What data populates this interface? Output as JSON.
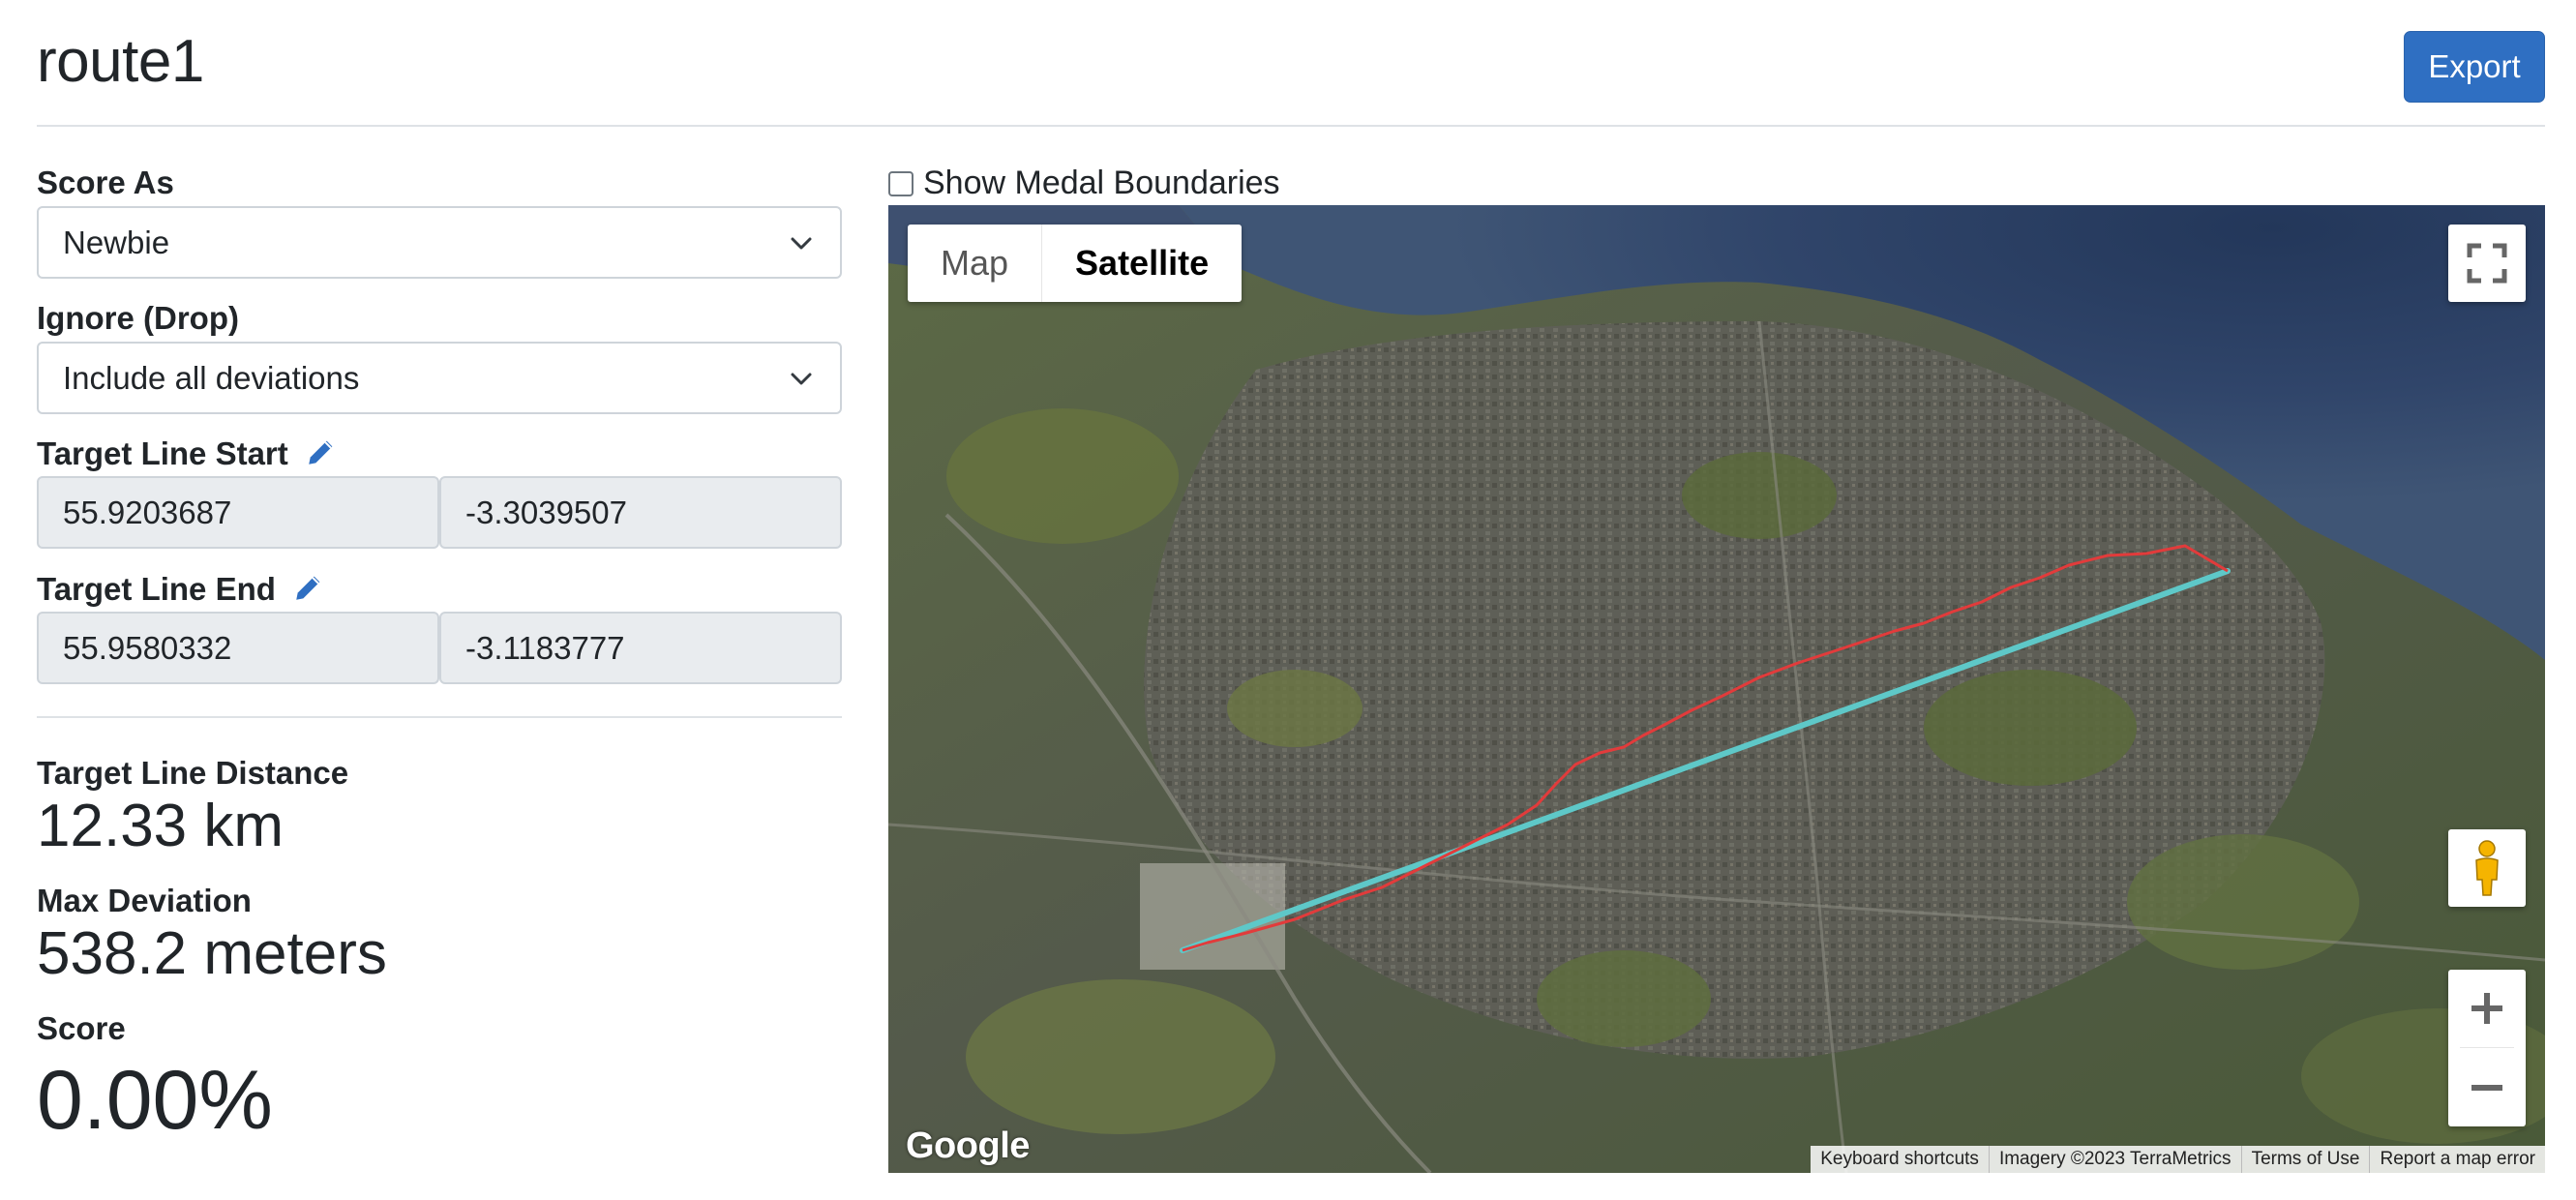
{
  "header": {
    "title": "route1",
    "export_label": "Export"
  },
  "form": {
    "score_as": {
      "label": "Score As",
      "value": "Newbie"
    },
    "ignore": {
      "label": "Ignore (Drop)",
      "value": "Include all deviations"
    },
    "target_start": {
      "label": "Target Line Start",
      "lat": "55.9203687",
      "lng": "-3.3039507"
    },
    "target_end": {
      "label": "Target Line End",
      "lat": "55.9580332",
      "lng": "-3.1183777"
    }
  },
  "stats": {
    "distance": {
      "label": "Target Line Distance",
      "value": "12.33 km"
    },
    "max_deviation": {
      "label": "Max Deviation",
      "value": "538.2 meters"
    },
    "score": {
      "label": "Score",
      "value": "0.00%"
    }
  },
  "map": {
    "medal_toggle_label": "Show Medal Boundaries",
    "medal_toggle_checked": false,
    "map_type_map": "Map",
    "map_type_satellite": "Satellite",
    "selected_map_type": "Satellite",
    "google_logo": "Google",
    "attribution": [
      "Keyboard shortcuts",
      "Imagery ©2023 TerraMetrics",
      "Terms of Use",
      "Report a map error"
    ],
    "target_line_color": "#5ec8c8",
    "route_line_color": "#e23b3b"
  },
  "colors": {
    "accent": "#2f6fc2"
  }
}
